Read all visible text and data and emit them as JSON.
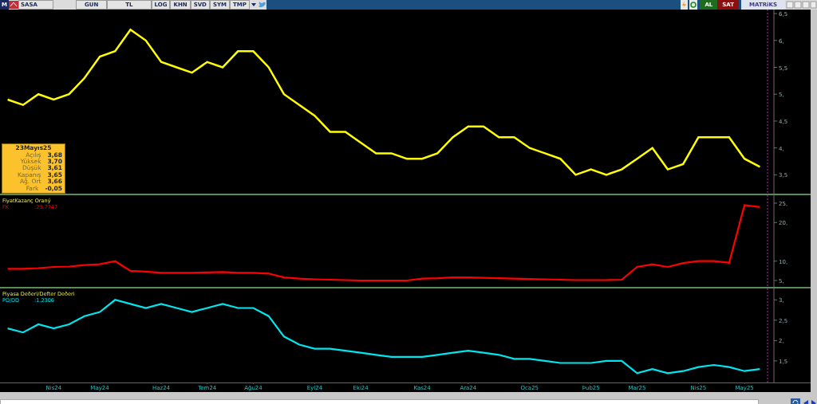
{
  "toolbar": {
    "logo": "M",
    "symbol": "SASA",
    "buttons": [
      "GUN",
      "TL",
      "LOG",
      "KHN",
      "SVD",
      "SYM",
      "TMP"
    ],
    "buy": "AL",
    "sell": "SAT",
    "brand": "MATRiKS"
  },
  "info_box": {
    "date": "23Mayıs25",
    "rows": [
      {
        "label": "Açılış",
        "value": "3,68"
      },
      {
        "label": "Yüksek",
        "value": "3,70"
      },
      {
        "label": "Düşük",
        "value": "3,61"
      },
      {
        "label": "Kapanış",
        "value": "3,65"
      },
      {
        "label": "Ağ. Ort",
        "value": "3,66"
      },
      {
        "label": "Fark",
        "value": "-0,05"
      }
    ]
  },
  "panels": [
    {
      "kind": "price",
      "chart_data": {
        "type": "line",
        "categories": [
          null,
          null,
          null,
          null,
          null,
          null,
          null,
          null,
          null,
          null,
          null,
          null,
          null,
          null,
          null,
          null,
          null,
          null,
          null,
          null,
          null,
          null,
          null,
          null,
          null,
          null,
          null,
          null,
          null,
          null,
          null,
          null,
          null,
          null,
          null,
          null,
          null,
          null,
          null,
          null,
          null,
          null,
          null,
          null,
          null,
          null,
          null,
          null,
          null,
          null
        ],
        "ylim": [
          3.15,
          6.575
        ],
        "yticks": [
          {
            "value": 3.5,
            "label": "3,5"
          },
          {
            "value": 4,
            "label": "4,"
          },
          {
            "value": 4.5,
            "label": "4,5"
          },
          {
            "value": 5,
            "label": "5,"
          },
          {
            "value": 5.5,
            "label": "5,5"
          },
          {
            "value": 6,
            "label": "6,"
          },
          {
            "value": 6.5,
            "label": "6,5"
          }
        ],
        "series": [
          {
            "color": "#ffff00",
            "values": [
              4.9,
              4.8,
              5.0,
              4.9,
              5.0,
              5.3,
              5.7,
              5.8,
              6.2,
              6.0,
              5.6,
              5.5,
              5.4,
              5.6,
              5.5,
              5.8,
              5.8,
              5.5,
              5.0,
              4.8,
              4.6,
              4.3,
              4.3,
              4.1,
              3.9,
              3.9,
              3.8,
              3.8,
              3.9,
              4.2,
              4.4,
              4.4,
              4.2,
              4.2,
              4.0,
              3.9,
              3.8,
              3.5,
              3.6,
              3.5,
              3.6,
              3.8,
              4.0,
              3.6,
              3.7,
              4.2,
              4.2,
              4.2,
              3.8,
              3.65
            ]
          }
        ]
      }
    },
    {
      "kind": "indicator",
      "title": "FiyatKazanç Oraný",
      "reading": ":23.7747",
      "chart_data": {
        "type": "line",
        "categories": [
          null,
          null,
          null,
          null,
          null,
          null,
          null,
          null,
          null,
          null,
          null,
          null,
          null,
          null,
          null,
          null,
          null,
          null,
          null,
          null,
          null,
          null,
          null,
          null,
          null,
          null,
          null,
          null,
          null,
          null,
          null,
          null,
          null,
          null,
          null,
          null,
          null,
          null,
          null,
          null,
          null,
          null,
          null,
          null,
          null,
          null,
          null,
          null,
          null,
          null
        ],
        "ylim": [
          3.35,
          27.06
        ],
        "yticks": [
          {
            "value": 5,
            "label": "5,"
          },
          {
            "value": 10,
            "label": "10,"
          },
          {
            "value": 20,
            "label": "20,"
          },
          {
            "value": 25,
            "label": "25,"
          }
        ],
        "series": [
          {
            "name": "FK",
            "color": "#ff0000",
            "values": [
              8,
              8,
              8.2,
              8.5,
              8.6,
              9,
              9.2,
              10,
              7.5,
              7.3,
              7,
              7,
              7,
              7.1,
              7.2,
              7,
              7,
              6.8,
              5.8,
              5.5,
              5.3,
              5.2,
              5.1,
              5,
              5,
              5,
              5,
              5.5,
              5.6,
              5.8,
              5.8,
              5.7,
              5.6,
              5.5,
              5.4,
              5.3,
              5.2,
              5.1,
              5.1,
              5.1,
              5.2,
              8.5,
              9.2,
              8.5,
              9.5,
              10,
              10,
              9.6,
              24.5,
              24
            ]
          }
        ]
      }
    },
    {
      "kind": "indicator",
      "title": "Piyasa Deðeri/Defter Deðeri",
      "reading": ":1.2306",
      "chart_data": {
        "type": "line",
        "categories": [
          null,
          null,
          null,
          "Nis24",
          null,
          null,
          "May24",
          null,
          null,
          null,
          "Haz24",
          null,
          null,
          "Tem24",
          null,
          null,
          "Ağu24",
          null,
          null,
          null,
          "Eyl24",
          null,
          null,
          "Eki24",
          null,
          null,
          null,
          "Kas24",
          null,
          null,
          "Ara24",
          null,
          null,
          null,
          "Oca25",
          null,
          null,
          null,
          "Þub25",
          null,
          null,
          "Mar25",
          null,
          null,
          null,
          "Nis25",
          null,
          null,
          "May25",
          null
        ],
        "ylim": [
          0.97,
          3.28
        ],
        "yticks": [
          {
            "value": 1.5,
            "label": "1,5"
          },
          {
            "value": 2,
            "label": "2,"
          },
          {
            "value": 2.5,
            "label": "2,5"
          },
          {
            "value": 3,
            "label": "3,"
          }
        ],
        "series": [
          {
            "name": "PD/DD",
            "color": "#00e5ee",
            "values": [
              2.3,
              2.2,
              2.4,
              2.3,
              2.4,
              2.6,
              2.7,
              3.0,
              2.9,
              2.8,
              2.9,
              2.8,
              2.7,
              2.8,
              2.9,
              2.8,
              2.8,
              2.6,
              2.1,
              1.9,
              1.8,
              1.8,
              1.75,
              1.7,
              1.65,
              1.6,
              1.6,
              1.6,
              1.65,
              1.7,
              1.75,
              1.7,
              1.65,
              1.55,
              1.55,
              1.5,
              1.45,
              1.45,
              1.45,
              1.5,
              1.5,
              1.2,
              1.3,
              1.2,
              1.25,
              1.35,
              1.4,
              1.35,
              1.25,
              1.3
            ]
          }
        ]
      }
    }
  ]
}
